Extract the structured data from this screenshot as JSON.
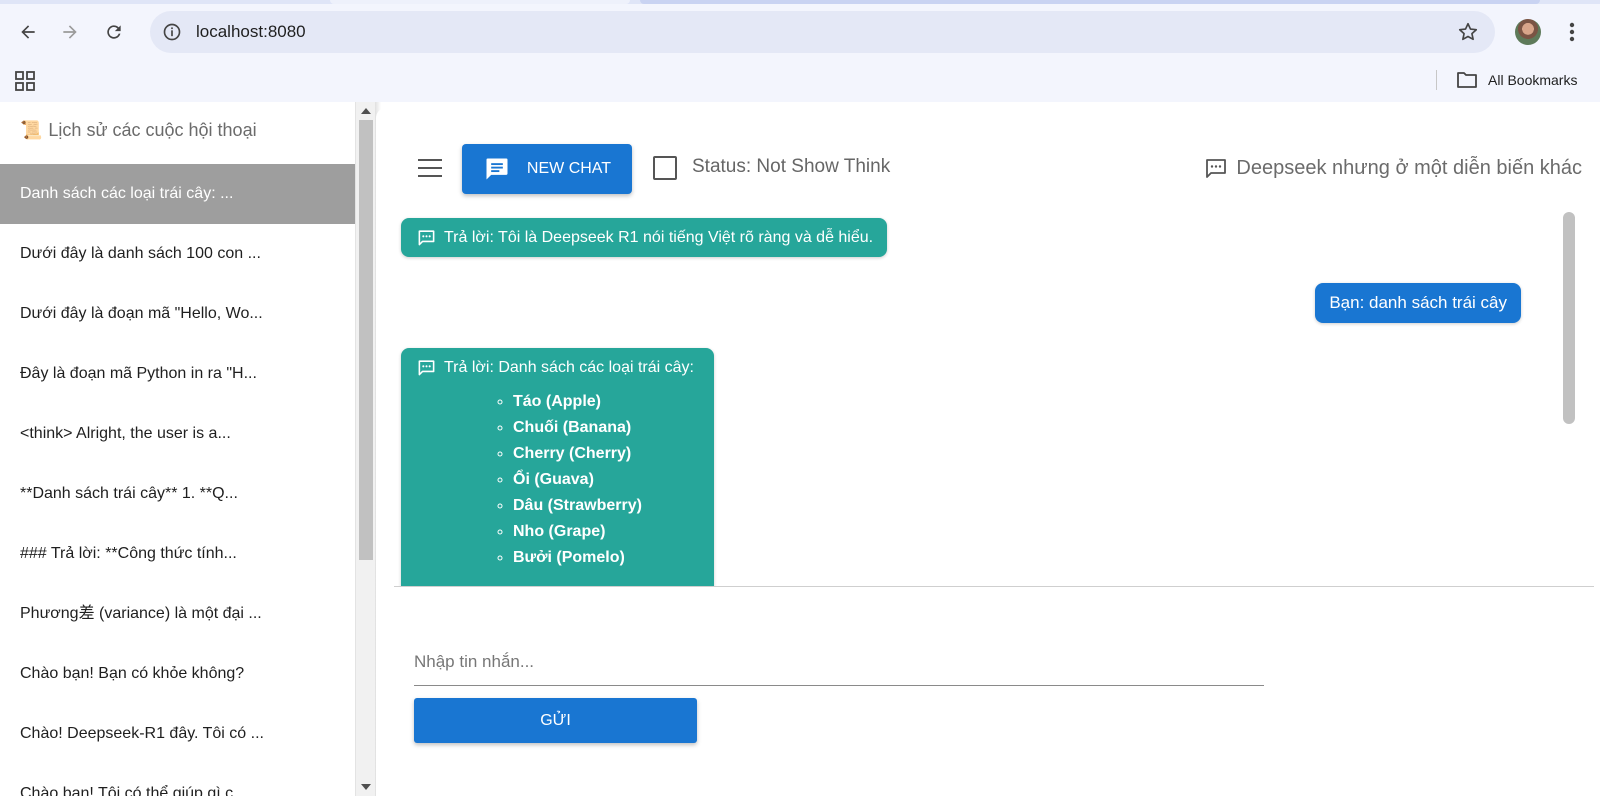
{
  "browser": {
    "url": "localhost:8080",
    "bookmarks_label": "All Bookmarks"
  },
  "sidebar": {
    "header": "Lịch sử các cuộc hội thoại",
    "items": [
      {
        "label": "Danh sách các loại trái cây: ...",
        "active": true
      },
      {
        "label": "Dưới đây là danh sách 100 con ..."
      },
      {
        "label": "Dưới đây là đoạn mã \"Hello, Wo..."
      },
      {
        "label": "Đây là đoạn mã Python in ra \"H..."
      },
      {
        "label": "<think> Alright, the user is a..."
      },
      {
        "label": "**Danh sách trái cây** 1. **Q..."
      },
      {
        "label": "### Trả lời: **Công thức tính..."
      },
      {
        "label": "Phương差 (variance) là một đại ..."
      },
      {
        "label": "Chào bạn! Bạn có khỏe không?"
      },
      {
        "label": "Chào! Deepseek-R1 đây. Tôi có ..."
      },
      {
        "label": "Chào bạn! Tôi có thể giúp gì c..."
      }
    ]
  },
  "header": {
    "new_chat_label": "NEW CHAT",
    "status_label": "Status: Not Show Think",
    "model_title": "Deepseek nhưng ở một diễn biến khác"
  },
  "chat": {
    "intro": "Trả lời: Tôi là Deepseek R1 nói tiếng Việt rõ ràng và dễ hiểu.",
    "user_message": "Bạn: danh sách trái cây",
    "answer_prefix": "Trả lời: Danh sách các loại trái cây:",
    "fruits": [
      "Táo (Apple)",
      "Chuối (Banana)",
      "Cherry (Cherry)",
      "Ổi (Guava)",
      "Dâu (Strawberry)",
      "Nho (Grape)",
      "Bưởi (Pomelo)"
    ]
  },
  "composer": {
    "placeholder": "Nhập tin nhắn...",
    "send_label": "GỬI"
  },
  "colors": {
    "primary": "#1976d2",
    "bot_bubble": "#26a69a",
    "active_item": "#9e9e9e"
  }
}
